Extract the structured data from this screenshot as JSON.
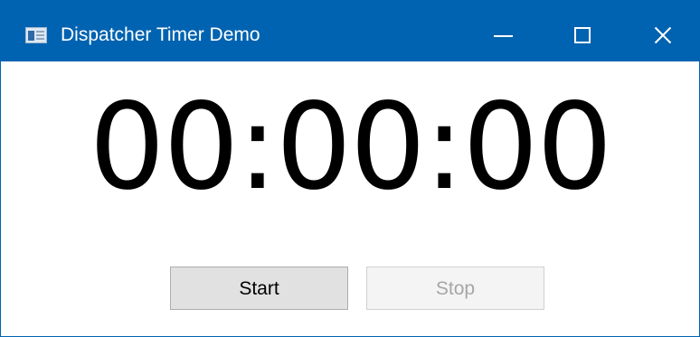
{
  "window": {
    "title": "Dispatcher Timer Demo",
    "accent_color": "#0063b1",
    "icon": "app-window-icon",
    "controls": {
      "minimize_icon": "minimize-icon",
      "maximize_icon": "maximize-icon",
      "close_icon": "close-icon"
    }
  },
  "timer": {
    "display": "00:00:00"
  },
  "buttons": {
    "start_label": "Start",
    "stop_label": "Stop",
    "stop_state": "disabled"
  }
}
